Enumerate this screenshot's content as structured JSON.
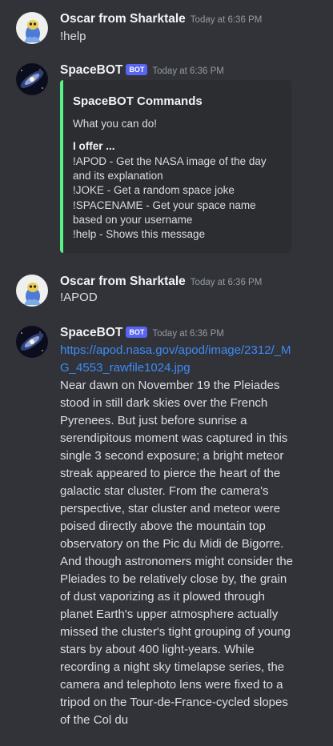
{
  "messages": [
    {
      "author": "Oscar from Sharktale",
      "timestamp": "Today at 6:36 PM",
      "text": "!help"
    },
    {
      "author": "SpaceBOT",
      "badge": "BOT",
      "timestamp": "Today at 6:36 PM",
      "embed": {
        "title": "SpaceBOT Commands",
        "description": "What you can do!",
        "subheading": "I offer ...",
        "accent_color": "#57f287",
        "items": [
          "!APOD - Get the NASA image of the day and its explanation",
          "!JOKE - Get a random space joke",
          "!SPACENAME - Get your space name based on your username",
          "!help - Shows this message"
        ]
      }
    },
    {
      "author": "Oscar from Sharktale",
      "timestamp": "Today at 6:36 PM",
      "text": "!APOD"
    },
    {
      "author": "SpaceBOT",
      "badge": "BOT",
      "timestamp": "Today at 6:36 PM",
      "link": "https://apod.nasa.gov/apod/image/2312/_MG_4553_rawfile1024.jpg",
      "text": "Near dawn on November 19 the Pleiades stood in still dark skies over the French Pyrenees. But just before sunrise a serendipitous moment was captured in this single 3 second exposure; a bright meteor streak appeared to pierce the heart of the galactic star cluster. From the camera's perspective, star cluster and meteor were poised directly above the mountain top observatory on the Pic du Midi de Bigorre. And though astronomers might consider the Pleiades to be relatively close by, the grain of dust vaporizing as it plowed through planet Earth's upper atmosphere actually missed the cluster's tight grouping of young stars by about 400 light-years. While recording a night sky timelapse series, the camera and telephoto lens were fixed to a tripod on the Tour-de-France-cycled slopes of the Col du"
    }
  ],
  "colors": {
    "background": "#323339",
    "embed_background": "#2b2d31",
    "bot_badge": "#5865f2",
    "link": "#3e8af5"
  }
}
